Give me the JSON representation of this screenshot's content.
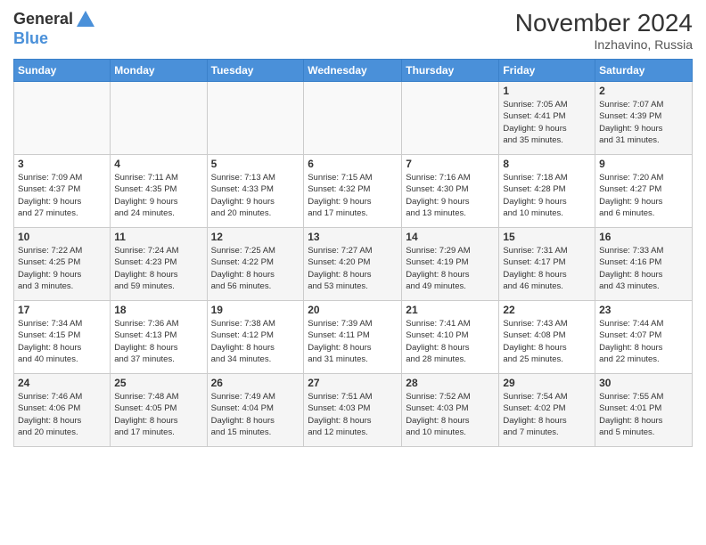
{
  "header": {
    "logo_general": "General",
    "logo_blue": "Blue",
    "month": "November 2024",
    "location": "Inzhavino, Russia"
  },
  "weekdays": [
    "Sunday",
    "Monday",
    "Tuesday",
    "Wednesday",
    "Thursday",
    "Friday",
    "Saturday"
  ],
  "weeks": [
    [
      {
        "day": "",
        "info": ""
      },
      {
        "day": "",
        "info": ""
      },
      {
        "day": "",
        "info": ""
      },
      {
        "day": "",
        "info": ""
      },
      {
        "day": "",
        "info": ""
      },
      {
        "day": "1",
        "info": "Sunrise: 7:05 AM\nSunset: 4:41 PM\nDaylight: 9 hours\nand 35 minutes."
      },
      {
        "day": "2",
        "info": "Sunrise: 7:07 AM\nSunset: 4:39 PM\nDaylight: 9 hours\nand 31 minutes."
      }
    ],
    [
      {
        "day": "3",
        "info": "Sunrise: 7:09 AM\nSunset: 4:37 PM\nDaylight: 9 hours\nand 27 minutes."
      },
      {
        "day": "4",
        "info": "Sunrise: 7:11 AM\nSunset: 4:35 PM\nDaylight: 9 hours\nand 24 minutes."
      },
      {
        "day": "5",
        "info": "Sunrise: 7:13 AM\nSunset: 4:33 PM\nDaylight: 9 hours\nand 20 minutes."
      },
      {
        "day": "6",
        "info": "Sunrise: 7:15 AM\nSunset: 4:32 PM\nDaylight: 9 hours\nand 17 minutes."
      },
      {
        "day": "7",
        "info": "Sunrise: 7:16 AM\nSunset: 4:30 PM\nDaylight: 9 hours\nand 13 minutes."
      },
      {
        "day": "8",
        "info": "Sunrise: 7:18 AM\nSunset: 4:28 PM\nDaylight: 9 hours\nand 10 minutes."
      },
      {
        "day": "9",
        "info": "Sunrise: 7:20 AM\nSunset: 4:27 PM\nDaylight: 9 hours\nand 6 minutes."
      }
    ],
    [
      {
        "day": "10",
        "info": "Sunrise: 7:22 AM\nSunset: 4:25 PM\nDaylight: 9 hours\nand 3 minutes."
      },
      {
        "day": "11",
        "info": "Sunrise: 7:24 AM\nSunset: 4:23 PM\nDaylight: 8 hours\nand 59 minutes."
      },
      {
        "day": "12",
        "info": "Sunrise: 7:25 AM\nSunset: 4:22 PM\nDaylight: 8 hours\nand 56 minutes."
      },
      {
        "day": "13",
        "info": "Sunrise: 7:27 AM\nSunset: 4:20 PM\nDaylight: 8 hours\nand 53 minutes."
      },
      {
        "day": "14",
        "info": "Sunrise: 7:29 AM\nSunset: 4:19 PM\nDaylight: 8 hours\nand 49 minutes."
      },
      {
        "day": "15",
        "info": "Sunrise: 7:31 AM\nSunset: 4:17 PM\nDaylight: 8 hours\nand 46 minutes."
      },
      {
        "day": "16",
        "info": "Sunrise: 7:33 AM\nSunset: 4:16 PM\nDaylight: 8 hours\nand 43 minutes."
      }
    ],
    [
      {
        "day": "17",
        "info": "Sunrise: 7:34 AM\nSunset: 4:15 PM\nDaylight: 8 hours\nand 40 minutes."
      },
      {
        "day": "18",
        "info": "Sunrise: 7:36 AM\nSunset: 4:13 PM\nDaylight: 8 hours\nand 37 minutes."
      },
      {
        "day": "19",
        "info": "Sunrise: 7:38 AM\nSunset: 4:12 PM\nDaylight: 8 hours\nand 34 minutes."
      },
      {
        "day": "20",
        "info": "Sunrise: 7:39 AM\nSunset: 4:11 PM\nDaylight: 8 hours\nand 31 minutes."
      },
      {
        "day": "21",
        "info": "Sunrise: 7:41 AM\nSunset: 4:10 PM\nDaylight: 8 hours\nand 28 minutes."
      },
      {
        "day": "22",
        "info": "Sunrise: 7:43 AM\nSunset: 4:08 PM\nDaylight: 8 hours\nand 25 minutes."
      },
      {
        "day": "23",
        "info": "Sunrise: 7:44 AM\nSunset: 4:07 PM\nDaylight: 8 hours\nand 22 minutes."
      }
    ],
    [
      {
        "day": "24",
        "info": "Sunrise: 7:46 AM\nSunset: 4:06 PM\nDaylight: 8 hours\nand 20 minutes."
      },
      {
        "day": "25",
        "info": "Sunrise: 7:48 AM\nSunset: 4:05 PM\nDaylight: 8 hours\nand 17 minutes."
      },
      {
        "day": "26",
        "info": "Sunrise: 7:49 AM\nSunset: 4:04 PM\nDaylight: 8 hours\nand 15 minutes."
      },
      {
        "day": "27",
        "info": "Sunrise: 7:51 AM\nSunset: 4:03 PM\nDaylight: 8 hours\nand 12 minutes."
      },
      {
        "day": "28",
        "info": "Sunrise: 7:52 AM\nSunset: 4:03 PM\nDaylight: 8 hours\nand 10 minutes."
      },
      {
        "day": "29",
        "info": "Sunrise: 7:54 AM\nSunset: 4:02 PM\nDaylight: 8 hours\nand 7 minutes."
      },
      {
        "day": "30",
        "info": "Sunrise: 7:55 AM\nSunset: 4:01 PM\nDaylight: 8 hours\nand 5 minutes."
      }
    ]
  ]
}
